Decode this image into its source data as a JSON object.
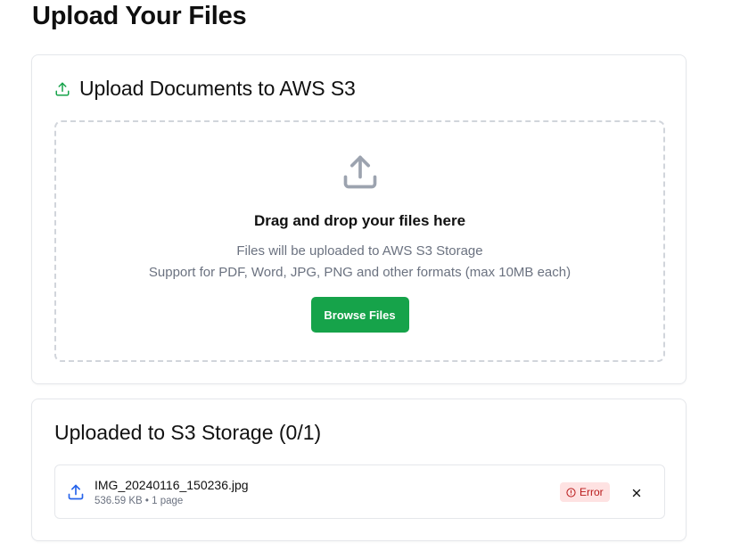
{
  "page": {
    "title": "Upload Your Files"
  },
  "upload_card": {
    "title": "Upload Documents to AWS S3",
    "header_icon": "upload-icon",
    "dropzone": {
      "icon": "upload-icon",
      "title": "Drag and drop your files here",
      "subtitle_1": "Files will be uploaded to AWS S3 Storage",
      "subtitle_2": "Support for PDF, Word, JPG, PNG and other formats (max 10MB each)",
      "browse_label": "Browse Files"
    }
  },
  "uploaded_card": {
    "title": "Uploaded to S3 Storage (0/1)",
    "files": [
      {
        "icon": "upload-icon",
        "name": "IMG_20240116_150236.jpg",
        "meta": "536.59 KB • 1 page",
        "status": "Error",
        "status_icon": "alert-circle-icon",
        "remove_icon": "close-icon"
      }
    ]
  },
  "colors": {
    "accent_green": "#16a34a",
    "error_bg": "#fee2e2",
    "error_text": "#b91c1c",
    "file_icon_blue": "#2563eb",
    "muted_text": "#6b7280",
    "border": "#e5e7eb",
    "dashed_border": "#d1d5db"
  }
}
